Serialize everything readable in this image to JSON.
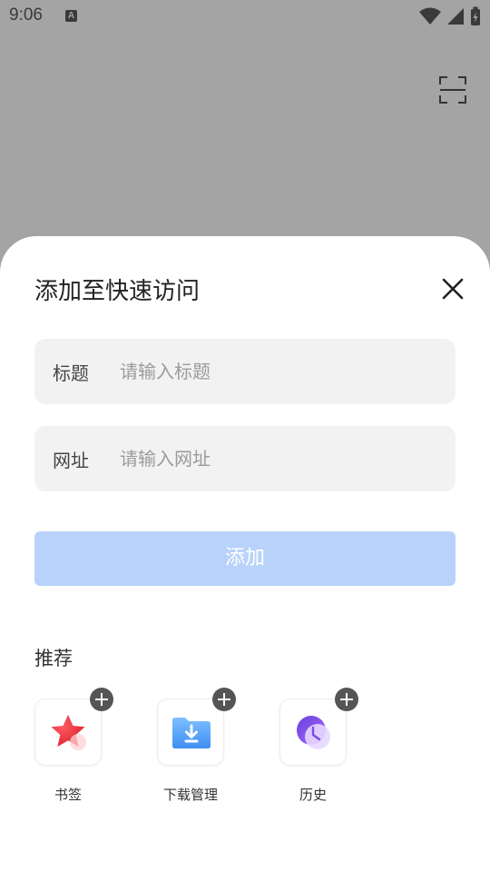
{
  "status_bar": {
    "time": "9:06",
    "notification_icon": "A"
  },
  "sheet": {
    "title": "添加至快速访问",
    "fields": [
      {
        "label": "标题",
        "placeholder": "请输入标题",
        "value": ""
      },
      {
        "label": "网址",
        "placeholder": "请输入网址",
        "value": ""
      }
    ],
    "add_button": "添加"
  },
  "recommend": {
    "title": "推荐",
    "items": [
      {
        "label": "书签",
        "icon": "star-icon",
        "color": "#e8333d"
      },
      {
        "label": "下载管理",
        "icon": "download-folder-icon",
        "color": "#4a9af5"
      },
      {
        "label": "历史",
        "icon": "history-clock-icon",
        "color": "#8a4ee8"
      }
    ]
  },
  "colors": {
    "overlay": "#a4a4a4",
    "add_button_disabled": "#b8d2fa",
    "field_bg": "#f2f2f2"
  }
}
